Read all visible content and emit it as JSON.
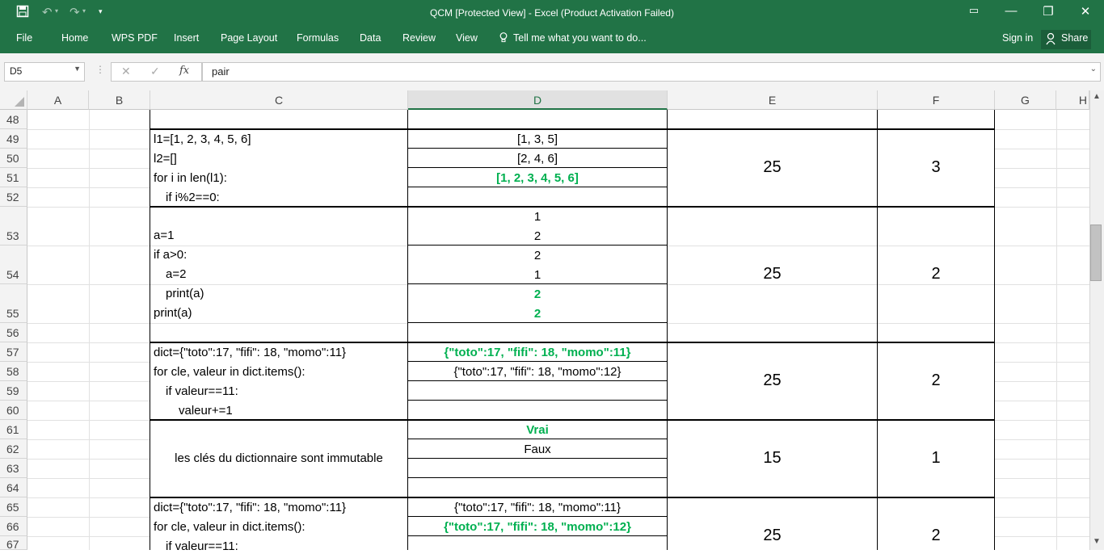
{
  "window": {
    "title": "QCM  [Protected View] - Excel (Product Activation Failed)",
    "save_icon": "save-icon",
    "undo_icon": "undo-icon",
    "redo_icon": "redo-icon",
    "minimize_icon": "minimize-icon",
    "restore_icon": "restore-icon",
    "close_icon": "close-icon"
  },
  "ribbon": {
    "tabs": [
      "File",
      "Home",
      "WPS PDF",
      "Insert",
      "Page Layout",
      "Formulas",
      "Data",
      "Review",
      "View"
    ],
    "tell_me": "Tell me what you want to do...",
    "sign_in": "Sign in",
    "share": "Share"
  },
  "formula_bar": {
    "name_box": "D5",
    "fx": "fx",
    "content": "pair"
  },
  "columns": [
    "A",
    "B",
    "C",
    "D",
    "E",
    "F",
    "G",
    "H"
  ],
  "selected_column": "D",
  "rows": [
    "48",
    "49",
    "50",
    "51",
    "52",
    "53",
    "54",
    "55",
    "56",
    "57",
    "58",
    "59",
    "60",
    "61",
    "62",
    "63",
    "64",
    "65",
    "66",
    "67"
  ],
  "cells": {
    "q1_code": [
      "l1=[1, 2, 3, 4, 5, 6]",
      "l2=[]",
      "for i in len(l1):",
      "    if i%2==0:"
    ],
    "q1_answers": [
      "[1, 3, 5]",
      "[2, 4, 6]",
      "[1, 2, 3, 4, 5, 6]"
    ],
    "q1_points": "25",
    "q1_count": "3",
    "q2_code": [
      "a=1",
      "if a>0:",
      "    a=2",
      "    print(a)",
      "print(a)"
    ],
    "q2_answers": [
      "1",
      "2",
      "2",
      "1",
      "2",
      "2"
    ],
    "q2_points": "25",
    "q2_count": "2",
    "q3_code": [
      "dict={\"toto\":17, \"fifi\": 18, \"momo\":11}",
      "for cle, valeur in dict.items():",
      "    if valeur==11:",
      "        valeur+=1"
    ],
    "q3_answers": [
      "{\"toto\":17, \"fifi\": 18, \"momo\":11}",
      "{\"toto\":17, \"fifi\": 18, \"momo\":12}"
    ],
    "q3_points": "25",
    "q3_count": "2",
    "q4_text": "les clés du dictionnaire sont immutable",
    "q4_answers": [
      "Vrai",
      "Faux"
    ],
    "q4_points": "15",
    "q4_count": "1",
    "q5_code": [
      "dict={\"toto\":17, \"fifi\": 18, \"momo\":11}",
      "for cle, valeur in dict.items():",
      "    if valeur==11:"
    ],
    "q5_answers": [
      "{\"toto\":17, \"fifi\": 18, \"momo\":11}",
      "{\"toto\":17, \"fifi\": 18, \"momo\":12}"
    ],
    "q5_points": "25",
    "q5_count": "2"
  },
  "colors": {
    "excel_green": "#217346",
    "correct_answer": "#00b050"
  }
}
